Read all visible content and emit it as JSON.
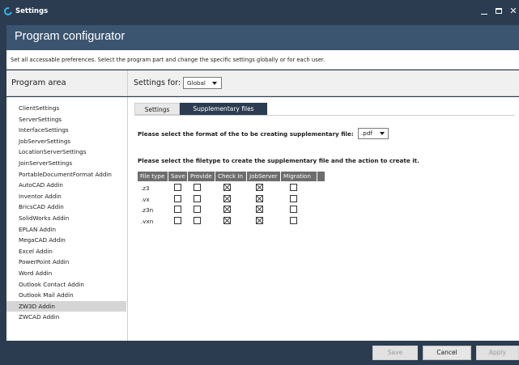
{
  "window": {
    "title": "Settings"
  },
  "header": {
    "title": "Program configurator"
  },
  "description": "Set all accessable preferences. Select the program part and change the specific settings globally or for each user.",
  "left": {
    "heading": "Program area",
    "items": [
      "ClientSettings",
      "ServerSettings",
      "InterfaceSettings",
      "JobServerSettings",
      "LocationServerSettings",
      "JoinServerSettings",
      "PortableDocumentFormat Addin",
      "AutoCAD Addin",
      "Inventor Addin",
      "BricsCAD Addin",
      "SolidWorks Addin",
      "EPLAN Addin",
      "MegaCAD Addin",
      "Excel Addin",
      "PowerPoint Addin",
      "Word Addin",
      "Outlook Contact Addin",
      "Outlook Mail Addin",
      "ZW3D Addin",
      "ZWCAD Addin"
    ],
    "selected": "ZW3D Addin"
  },
  "settings_for": {
    "label": "Settings for:",
    "value": "Global"
  },
  "tabs": {
    "settings": "Settings",
    "supplementary": "Supplementary files",
    "active": "supplementary"
  },
  "format": {
    "label": "Please select the format of the to be creating supplementary file:",
    "value": ".pdf"
  },
  "filetype": {
    "label": "Please select the filetype to create the supplementary file and the action to create it.",
    "columns": [
      "File type",
      "Save",
      "Provide",
      "Check In",
      "JobServer",
      "Migration"
    ],
    "rows": [
      {
        "type": ".z3",
        "save": false,
        "provide": false,
        "checkin": true,
        "jobserver": true,
        "migration": false
      },
      {
        "type": ".vx",
        "save": false,
        "provide": false,
        "checkin": true,
        "jobserver": true,
        "migration": false
      },
      {
        "type": ".z3n",
        "save": false,
        "provide": false,
        "checkin": true,
        "jobserver": true,
        "migration": false
      },
      {
        "type": ".vxn",
        "save": false,
        "provide": false,
        "checkin": true,
        "jobserver": true,
        "migration": false
      }
    ]
  },
  "footer": {
    "save": "Save",
    "cancel": "Cancel",
    "apply": "Apply"
  },
  "colors": {
    "titlebar": "#2b3c50",
    "header": "#3b5470",
    "table_header": "#6d6d6d",
    "selected_item": "#d5d5d5",
    "icon_accent": "#38b6e8"
  }
}
